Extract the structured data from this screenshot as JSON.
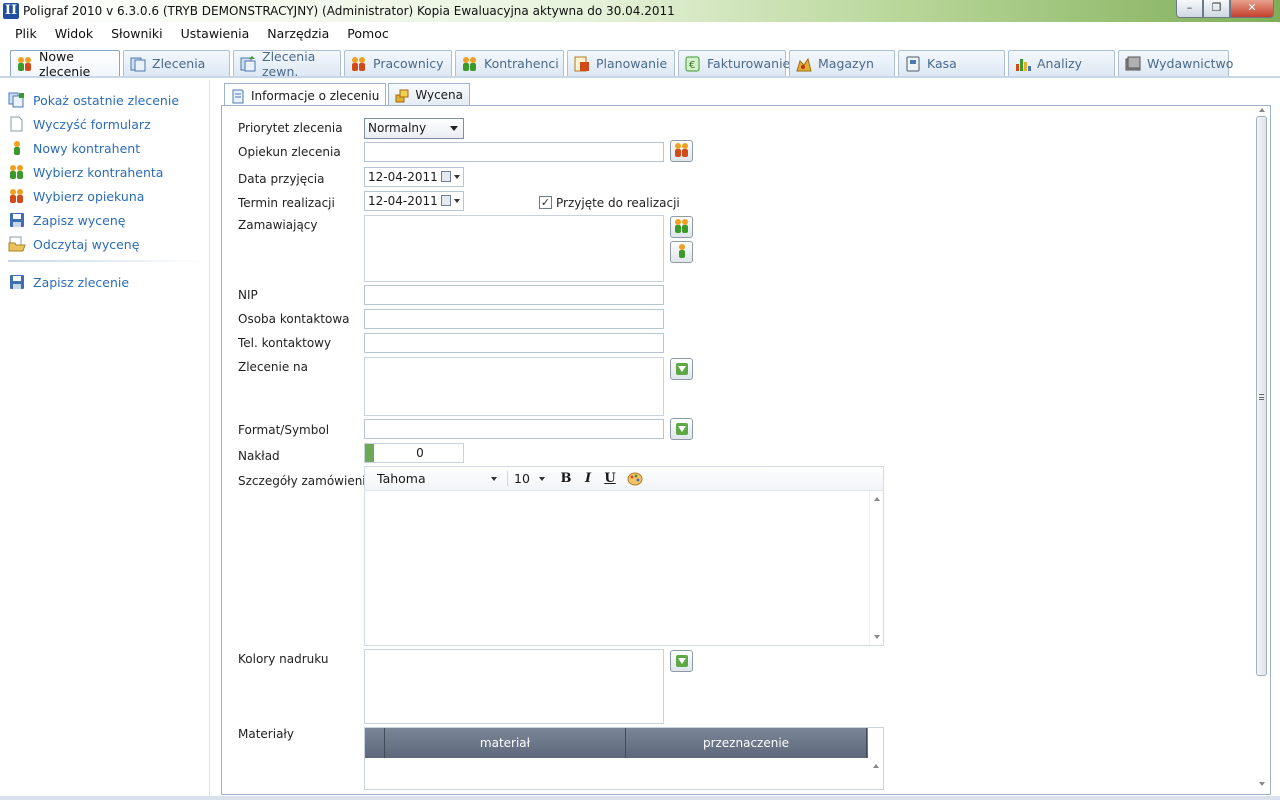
{
  "window": {
    "title": "Poligraf 2010 v 6.3.0.6 (TRYB DEMONSTRACYJNY) (Administrator) Kopia Ewaluacyjna aktywna do 30.04.2011",
    "app_icon": "II"
  },
  "menu": [
    "Plik",
    "Widok",
    "Słowniki",
    "Ustawienia",
    "Narzędzia",
    "Pomoc"
  ],
  "module_tabs": [
    {
      "label": "Nowe zlecenie",
      "icon": "people-icon",
      "active": true
    },
    {
      "label": "Zlecenia",
      "icon": "documents-icon"
    },
    {
      "label": "Zlecenia zewn.",
      "icon": "documents-export-icon"
    },
    {
      "label": "Pracownicy",
      "icon": "workers-icon"
    },
    {
      "label": "Kontrahenci",
      "icon": "contractors-icon"
    },
    {
      "label": "Planowanie",
      "icon": "planning-icon"
    },
    {
      "label": "Fakturowanie",
      "icon": "euro-icon"
    },
    {
      "label": "Magazyn",
      "icon": "warehouse-icon"
    },
    {
      "label": "Kasa",
      "icon": "cash-icon"
    },
    {
      "label": "Analizy",
      "icon": "bar-chart-icon"
    },
    {
      "label": "Wydawnictwo",
      "icon": "book-icon"
    }
  ],
  "sidebar": {
    "items": [
      {
        "label": "Pokaż ostatnie zlecenie",
        "icon": "documents-icon"
      },
      {
        "label": "Wyczyść formularz",
        "icon": "blank-page-icon"
      },
      {
        "label": "Nowy kontrahent",
        "icon": "person-green-icon"
      },
      {
        "label": "Wybierz kontrahenta",
        "icon": "people-green-icon"
      },
      {
        "label": "Wybierz opiekuna",
        "icon": "people-orange-icon"
      },
      {
        "label": "Zapisz wycenę",
        "icon": "floppy-icon"
      },
      {
        "label": "Odczytaj wycenę",
        "icon": "open-folder-icon"
      },
      {
        "label": "Zapisz zlecenie",
        "icon": "floppy-icon"
      }
    ]
  },
  "subtabs": [
    {
      "label": "Informacje o zleceniu",
      "icon": "form-icon",
      "active": true
    },
    {
      "label": "Wycena",
      "icon": "coins-icon"
    }
  ],
  "form": {
    "priorytet": {
      "label": "Priorytet zlecenia",
      "value": "Normalny"
    },
    "opiekun": {
      "label": "Opiekun zlecenia",
      "value": ""
    },
    "data_przyjecia": {
      "label": "Data przyjęcia",
      "value": "12-04-2011"
    },
    "termin": {
      "label": "Termin realizacji",
      "value": "12-04-2011"
    },
    "przyjete": {
      "label": "Przyjęte do realizacji",
      "checked": true,
      "mark": "✓"
    },
    "zamawiajacy": {
      "label": "Zamawiający",
      "value": ""
    },
    "nip": {
      "label": "NIP",
      "value": ""
    },
    "osoba": {
      "label": "Osoba kontaktowa",
      "value": ""
    },
    "tel": {
      "label": "Tel. kontaktowy",
      "value": ""
    },
    "zlecenie_na": {
      "label": "Zlecenie na",
      "value": ""
    },
    "format": {
      "label": "Format/Symbol",
      "value": ""
    },
    "naklad": {
      "label": "Nakład",
      "value": "0"
    },
    "szczegoly": {
      "label": "Szczegóły zamówienia",
      "font": "Tahoma",
      "size": "10",
      "bold": "B",
      "italic": "I",
      "underline": "U"
    },
    "kolory": {
      "label": "Kolory nadruku",
      "value": ""
    },
    "materialy": {
      "label": "Materiały",
      "columns": [
        "materiał",
        "przeznaczenie"
      ]
    }
  },
  "colors": {
    "link": "#2b6cb8",
    "accent_green": "#5ea845"
  }
}
